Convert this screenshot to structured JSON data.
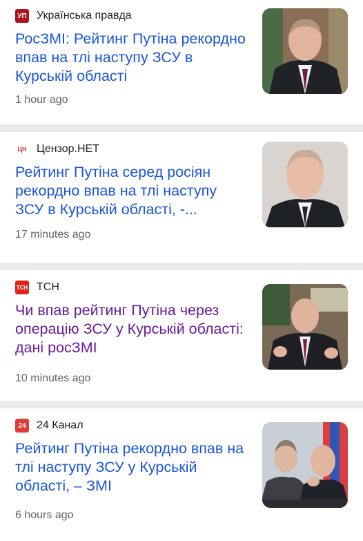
{
  "articles": [
    {
      "source": "Українська правда",
      "logo_text": "УП",
      "logo_color": "#b0131a",
      "headline": "РосЗМІ: Рейтинг Путіна рекордно впав на тлі наступу ЗСУ в Курській області",
      "time": "1 hour ago",
      "visited": false,
      "thumb_icon": "person-portrait-photo"
    },
    {
      "source": "Цензор.НЕТ",
      "logo_text": "ЦН",
      "logo_color": "#c62828",
      "headline": "Рейтинг Путіна серед росіян рекордно впав на тлі наступу ЗСУ в Курській області, -...",
      "time": "17 minutes ago",
      "visited": false,
      "thumb_icon": "person-portrait-photo"
    },
    {
      "source": "ТСН",
      "logo_text": "ТСН",
      "logo_color": "#e2231a",
      "headline": "Чи впав рейтинг Путіна через операцію ЗСУ у Курській області: дані росЗМІ",
      "time": "10 minutes ago",
      "visited": true,
      "thumb_icon": "person-speaking-photo"
    },
    {
      "source": "24 Канал",
      "logo_text": "24",
      "logo_color": "#e53935",
      "headline": "Рейтинг Путіна рекордно впав на тлі наступу ЗСУ у Курській області, – ЗМІ",
      "time": "6 hours ago",
      "visited": false,
      "thumb_icon": "meeting-photo"
    }
  ],
  "colors": {
    "link": "#1a56db",
    "visited": "#6a1b9a",
    "meta": "#5f6368",
    "separator": "#e9e9ec"
  }
}
